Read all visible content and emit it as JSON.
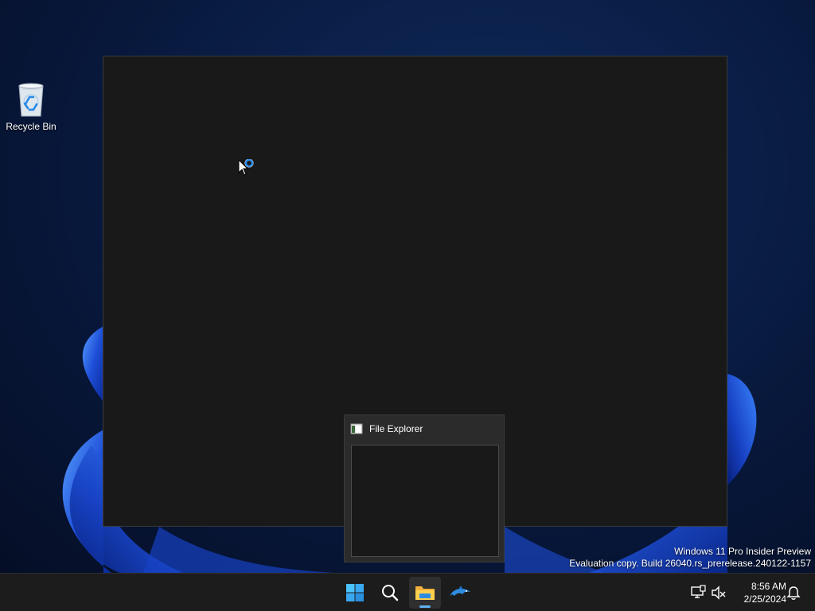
{
  "desktop": {
    "icons": [
      {
        "label": "Recycle Bin",
        "icon": "recycle-bin-icon"
      }
    ],
    "watermark": {
      "line1": "Windows 11 Pro Insider Preview",
      "line2": "Evaluation copy. Build 26040.rs_prerelease.240122-1157"
    }
  },
  "cursor": {
    "icon": "busy-pointer-icon"
  },
  "preview": {
    "title": "File Explorer",
    "icon": "file-explorer-app-icon"
  },
  "taskbar": {
    "buttons": [
      {
        "icon": "start-windows-icon",
        "active": false
      },
      {
        "icon": "search-icon",
        "active": false
      },
      {
        "icon": "file-explorer-folder-icon",
        "active": true
      },
      {
        "icon": "dolphin-app-icon",
        "active": false
      }
    ],
    "tray": {
      "icons": [
        "network-icon",
        "volume-muted-icon",
        "notification-bell-icon"
      ],
      "time": "8:56 AM",
      "date": "2/25/2024"
    }
  },
  "colors": {
    "accent": "#5fb2f2",
    "window_bg": "#191919",
    "taskbar_bg": "#1c1c1c",
    "wallpaper_blue": "#1e4fd8"
  }
}
